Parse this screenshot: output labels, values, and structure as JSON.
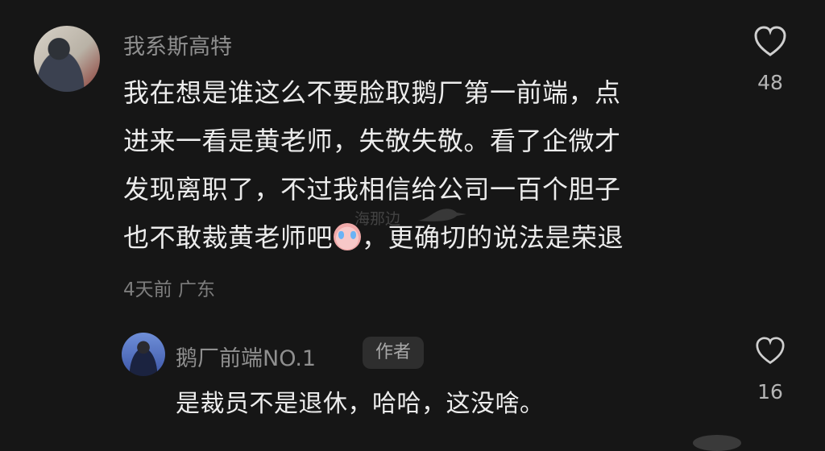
{
  "comment": {
    "username": "我系斯高特",
    "lines": [
      "我在想是谁这么不要脸取鹅厂第一前端，点",
      "进来一看是黄老师，失敬失敬。看了企微才",
      "发现离职了，不过我相信给公司一百个胆子",
      "也不敢裁黄老师吧",
      "，更确切的说法是荣退"
    ],
    "emoji": "crying-face-emoji",
    "meta": "4天前 广东",
    "like_count": "48"
  },
  "reply": {
    "username": "鹅厂前端NO.1",
    "badge": "作者",
    "text": "是裁员不是退休，哈哈，这没啥。",
    "like_count": "16"
  },
  "watermark": {
    "text": "海那边"
  },
  "colors": {
    "background": "#161616",
    "text_primary": "#ececec",
    "text_secondary": "#8f8f8f",
    "badge_bg": "#2e2e2e"
  }
}
